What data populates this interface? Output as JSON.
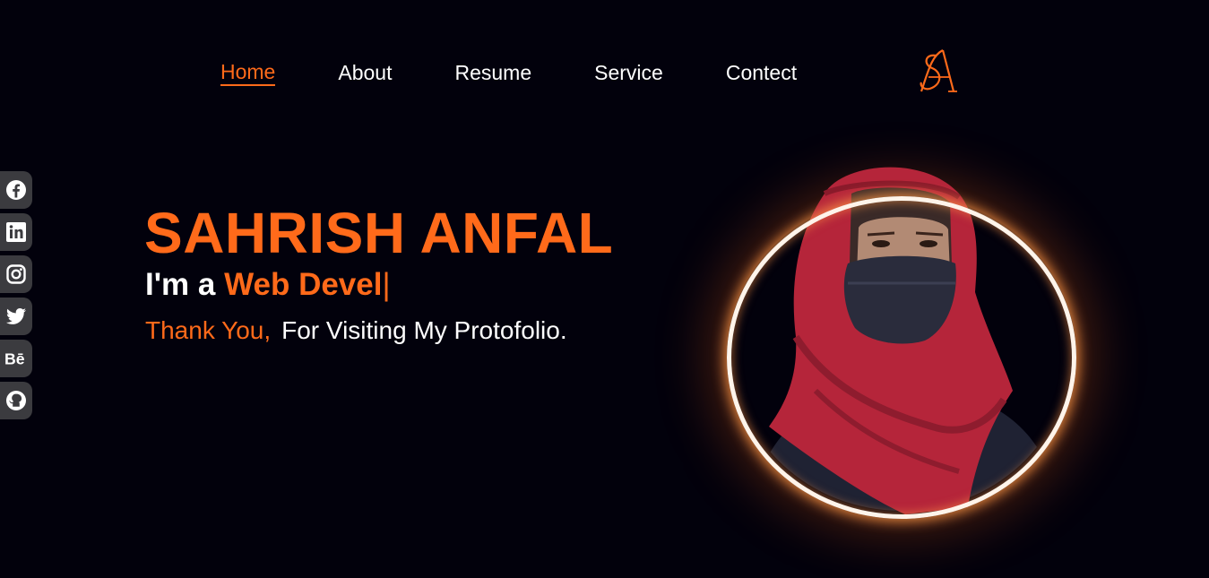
{
  "nav": {
    "items": [
      {
        "label": "Home",
        "active": true
      },
      {
        "label": "About",
        "active": false
      },
      {
        "label": "Resume",
        "active": false
      },
      {
        "label": "Service",
        "active": false
      },
      {
        "label": "Contect",
        "active": false
      }
    ],
    "logo_icon": "sa-monogram-logo"
  },
  "social": [
    {
      "icon": "facebook-icon"
    },
    {
      "icon": "linkedin-icon"
    },
    {
      "icon": "instagram-icon"
    },
    {
      "icon": "twitter-icon"
    },
    {
      "icon": "behance-icon"
    },
    {
      "icon": "github-icon"
    }
  ],
  "hero": {
    "name": "SAHRISH ANFAL",
    "role_prefix": "I'm a ",
    "role_typed": "Web Devel",
    "cursor": "|",
    "thanks": "Thank You,",
    "visiting": "For Visiting My Protofolio."
  },
  "colors": {
    "accent": "#ff6a1a",
    "background": "#02010c",
    "social_bg": "#3b3b3f"
  }
}
